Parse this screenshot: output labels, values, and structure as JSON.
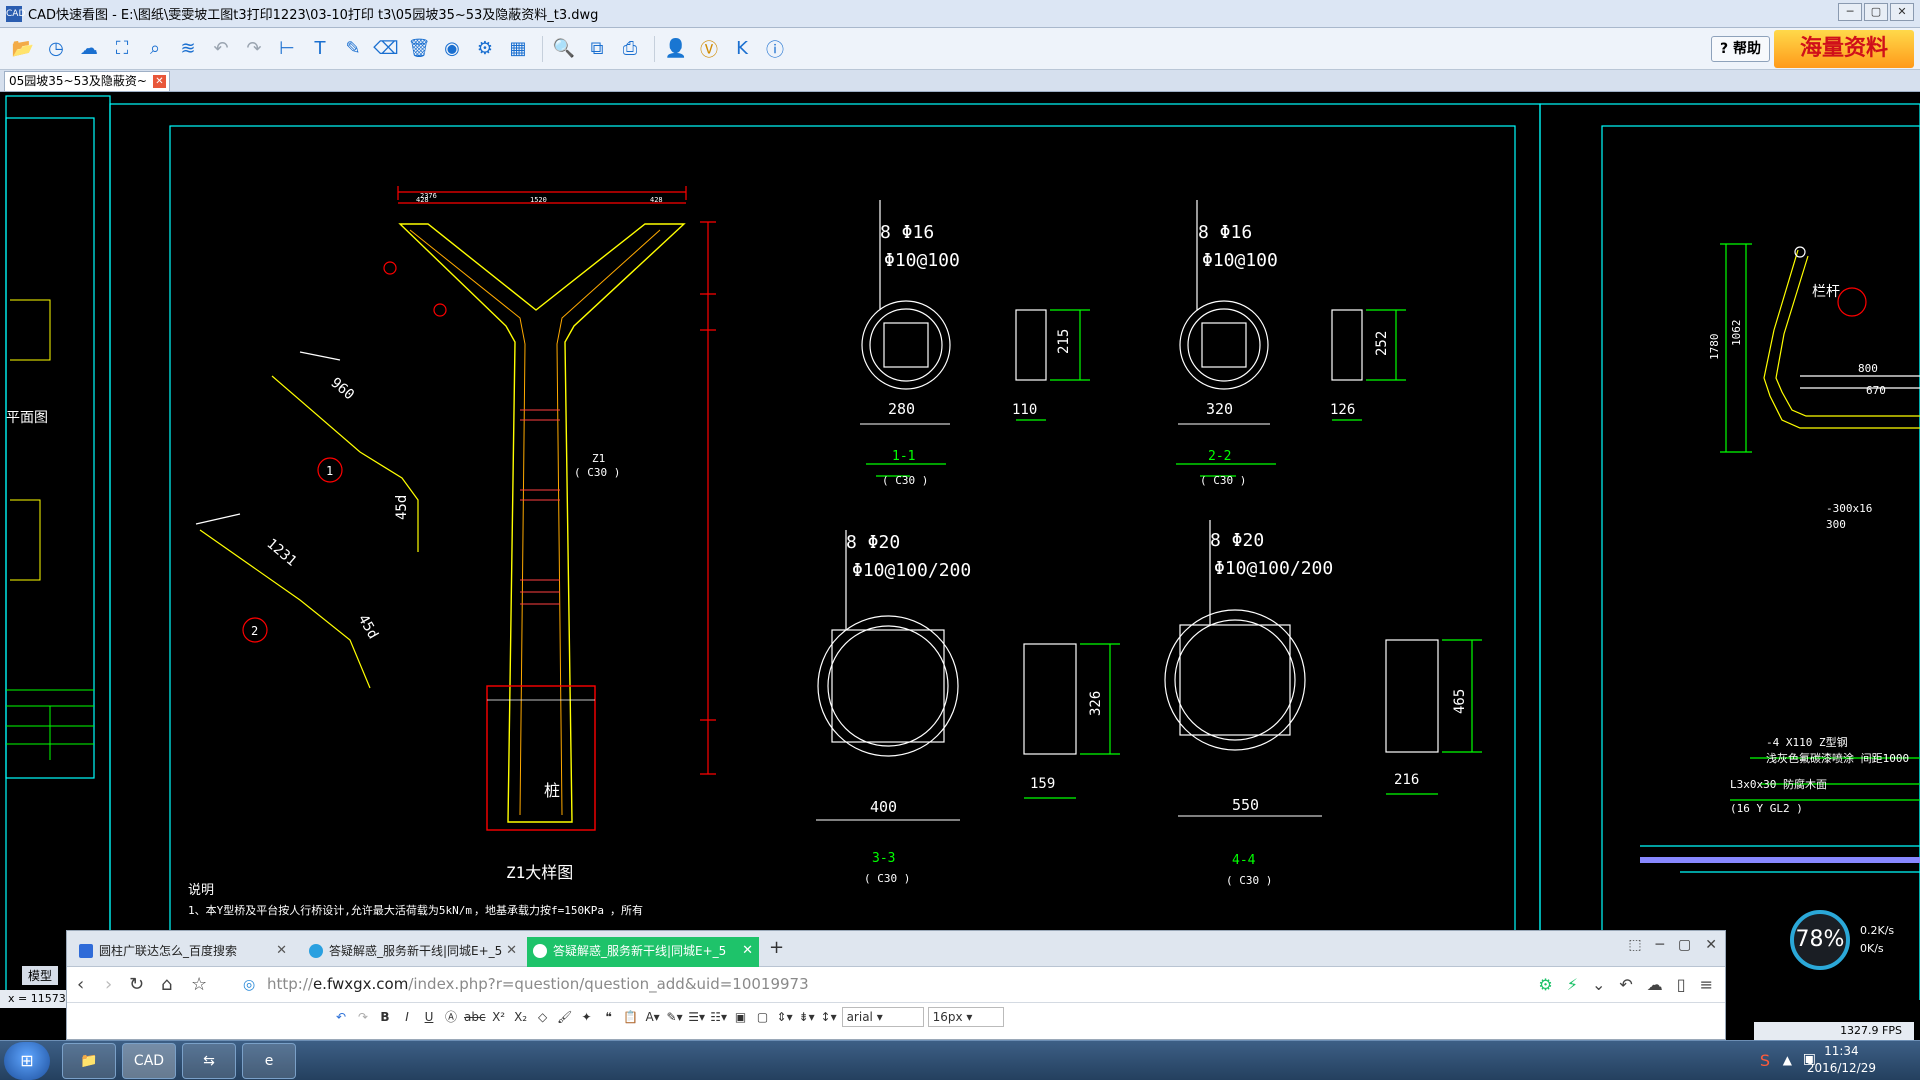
{
  "window": {
    "title": "CAD快速看图 - E:\\图纸\\雯雯坡工图t3打印1223\\03-10打印 t3\\05园坡35~53及隐蔽资料_t3.dwg",
    "app_icon": "CAD",
    "controls": [
      "─",
      "▢",
      "✕"
    ]
  },
  "toolbar": {
    "icons": [
      "open-icon",
      "recent-icon",
      "cloud-icon",
      "fit-icon",
      "zoom-window-icon",
      "layers-icon",
      "undo-icon",
      "redo-icon",
      "measure-icon",
      "text-icon",
      "pen-icon",
      "eraser-icon",
      "delete-icon",
      "hide-icon",
      "settings-icon",
      "compare-icon",
      "magnifier-icon",
      "copy-icon",
      "print-icon",
      "user-icon",
      "vip-icon",
      "k-icon",
      "info-icon"
    ],
    "help_label": "帮助",
    "promo_label": "海量资料"
  },
  "doc_tab": {
    "label": "05园坡35~53及隐蔽资~",
    "close": "✕"
  },
  "cad": {
    "section_1_1": {
      "bar_main": "8 Φ16",
      "bar_stirrup": "Φ10@100",
      "diameter": "280",
      "plate_h": "215",
      "plate_w": "110",
      "name": "1-1",
      "grade": "( C30 )"
    },
    "section_2_2": {
      "bar_main": "8 Φ16",
      "bar_stirrup": "Φ10@100",
      "diameter": "320",
      "plate_h": "252",
      "plate_w": "126",
      "name": "2-2",
      "grade": "( C30 )"
    },
    "section_3_3": {
      "bar_main": "8 Φ20",
      "bar_stirrup": "Φ10@100/200",
      "diameter": "400",
      "plate_h": "326",
      "plate_w": "159",
      "name": "3-3",
      "grade": "( C30 )"
    },
    "section_4_4": {
      "bar_main": "8 Φ20",
      "bar_stirrup": "Φ10@100/200",
      "diameter": "550",
      "plate_h": "465",
      "plate_w": "216",
      "name": "4-4",
      "grade": "( C30 )"
    },
    "column_title": "Z1大样图",
    "column_label": "Z1",
    "column_grade": "( C30 )",
    "pile_label": "桩",
    "bar1_len": "960",
    "bar1_anchor": "45d",
    "bar1_no": "1",
    "bar2_len": "1231",
    "bar2_anchor": "45d",
    "bar2_no": "2",
    "notes_title": "说明",
    "notes_line1": "1、本Y型桥及平台按人行桥设计,允许最大活荷载为5kN/m",
    "notes_line2": "，地基承载力按f=150KPa",
    "notes_line3": "，所有",
    "left_label": "平面图",
    "right_label_rail": "栏杆",
    "right_dim1": "800",
    "right_dim2": "670",
    "right_dim3": "1780",
    "right_dim4": "1062",
    "right_note1": "-4 X110 Z型钢",
    "right_note2": "浅灰色氟碳漆喷涂 间距1000",
    "right_note3": "L3x0x30 防腐木面",
    "right_note4": "(16 Y GL2 )",
    "right_note5": "-300x16",
    "right_note6": "300",
    "top_dims": {
      "total": "2376",
      "left": "428",
      "mid": "1520",
      "right": "428"
    },
    "col_widths": {
      "top": "400",
      "base": "550"
    }
  },
  "status": {
    "model_tab": "模型",
    "coord": "x = 11573",
    "fps": "1327.9 FPS"
  },
  "browser": {
    "tabs": [
      {
        "label": "圆柱广联达怎么_百度搜索",
        "close": "✕"
      },
      {
        "label": "答疑解惑_服务新干线|同城E+_5",
        "close": "✕"
      },
      {
        "label": "答疑解惑_服务新干线|同城E+_5",
        "close": "✕"
      }
    ],
    "new_tab": "+",
    "controls": [
      "⬚",
      "─",
      "▢",
      "✕"
    ],
    "url_prefix": "http://",
    "url_domain": "e.fwxgx.com",
    "url_path": "/index.php?r=question/question_add&uid=10019973",
    "font_family_value": "arial",
    "font_size_value": "16px"
  },
  "netmon": {
    "percent": "78%",
    "up": "0.2K/s",
    "down": "0K/s"
  },
  "taskbar": {
    "start": "⊞",
    "apps": [
      "folder-app",
      "CAD",
      "teamviewer-app",
      "browser-app"
    ],
    "cad_label": "CAD",
    "time": "11:34",
    "date": "2016/12/29"
  },
  "colors": {
    "cad_cyan": "#00ffff",
    "cad_yellow": "#ffff00",
    "cad_red": "#ff0000",
    "cad_green": "#00ff00",
    "browser_active_tab": "#1ec36a"
  }
}
